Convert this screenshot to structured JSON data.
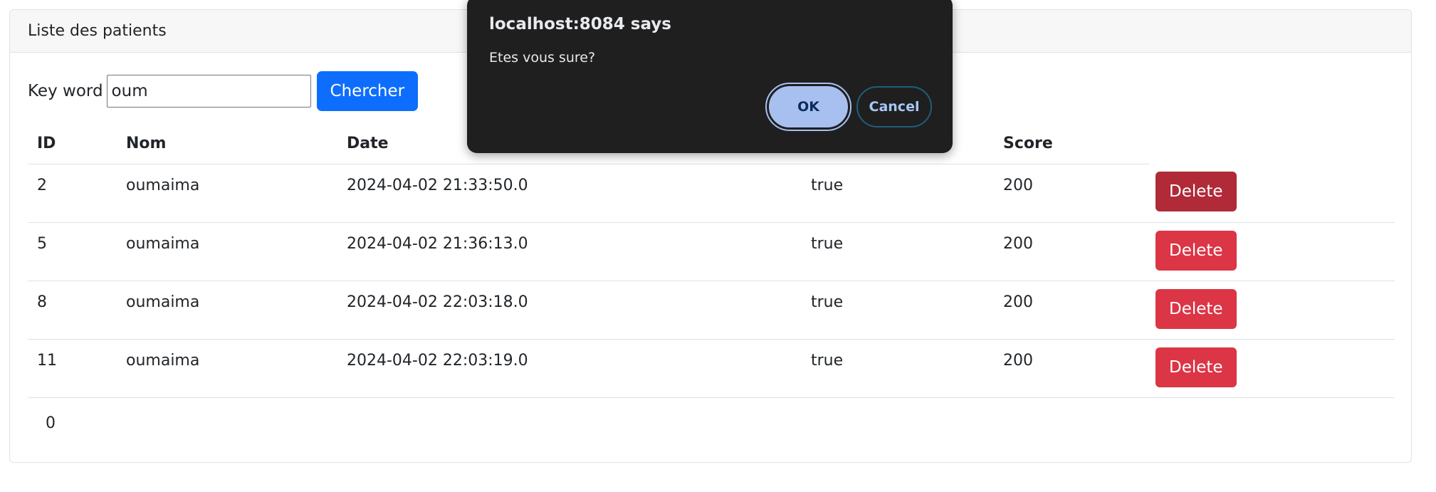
{
  "card": {
    "title": "Liste des patients"
  },
  "search": {
    "label": "Key word",
    "value": "oum",
    "button_label": "Chercher"
  },
  "table": {
    "columns": [
      "ID",
      "Nom",
      "Date",
      "",
      "Score",
      ""
    ],
    "rows": [
      {
        "id": "2",
        "nom": "oumaima",
        "date": "2024-04-02 21:33:50.0",
        "malade": "true",
        "score": "200",
        "action": "Delete"
      },
      {
        "id": "5",
        "nom": "oumaima",
        "date": "2024-04-02 21:36:13.0",
        "malade": "true",
        "score": "200",
        "action": "Delete"
      },
      {
        "id": "8",
        "nom": "oumaima",
        "date": "2024-04-02 22:03:18.0",
        "malade": "true",
        "score": "200",
        "action": "Delete"
      },
      {
        "id": "11",
        "nom": "oumaima",
        "date": "2024-04-02 22:03:19.0",
        "malade": "true",
        "score": "200",
        "action": "Delete"
      }
    ]
  },
  "pagination": {
    "pages": [
      "0"
    ]
  },
  "dialog": {
    "title": "localhost:8084 says",
    "message": "Etes vous sure?",
    "ok_label": "OK",
    "cancel_label": "Cancel"
  },
  "colors": {
    "primary": "#0d6efd",
    "danger": "#dc3545",
    "danger_hover": "#b02a37",
    "dialog_bg": "#1f1f1f",
    "dialog_ok_bg": "#a8c0f0"
  }
}
